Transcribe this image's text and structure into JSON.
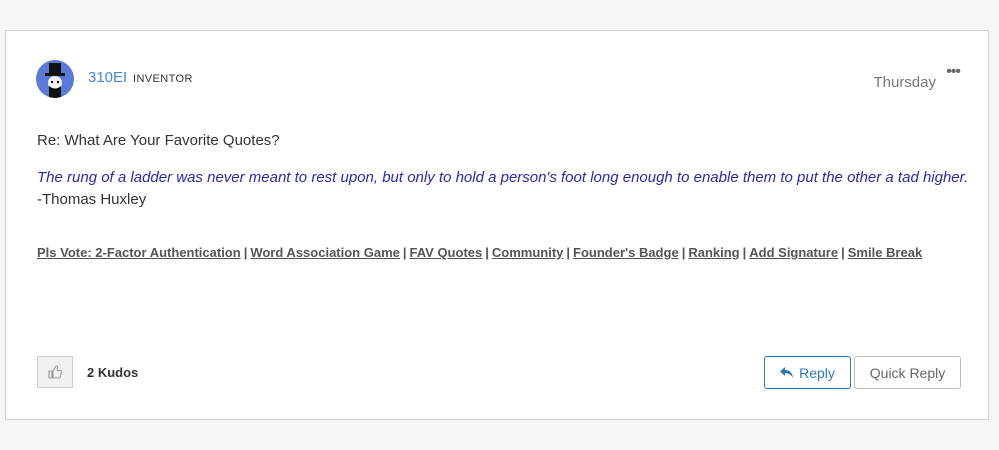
{
  "post": {
    "username": "310EI",
    "rank": "INVENTOR",
    "date": "Thursday",
    "more_icon": "ellipsis-icon",
    "subject": "Re: What Are Your Favorite Quotes?",
    "quote": "The rung of a ladder was never meant to rest upon, but only to hold a person's foot long enough to enable them to put the other a tad higher.",
    "author": " -Thomas Huxley"
  },
  "signature": {
    "links": [
      "Pls Vote: 2-Factor Authentication",
      "Word Association Game",
      "FAV Quotes",
      "Community",
      "Founder's Badge",
      "Ranking",
      "Add Signature",
      "Smile Break"
    ],
    "separator": "|"
  },
  "footer": {
    "kudos_icon": "thumbs-up-icon",
    "kudos_count": "2 Kudos",
    "reply_icon": "reply-arrow-icon",
    "reply_label": "Reply",
    "quick_reply_label": "Quick Reply"
  },
  "colors": {
    "link_blue": "#3f8ad6",
    "quote_text": "#2a2ab0",
    "reply_blue": "#2d7ab8"
  }
}
